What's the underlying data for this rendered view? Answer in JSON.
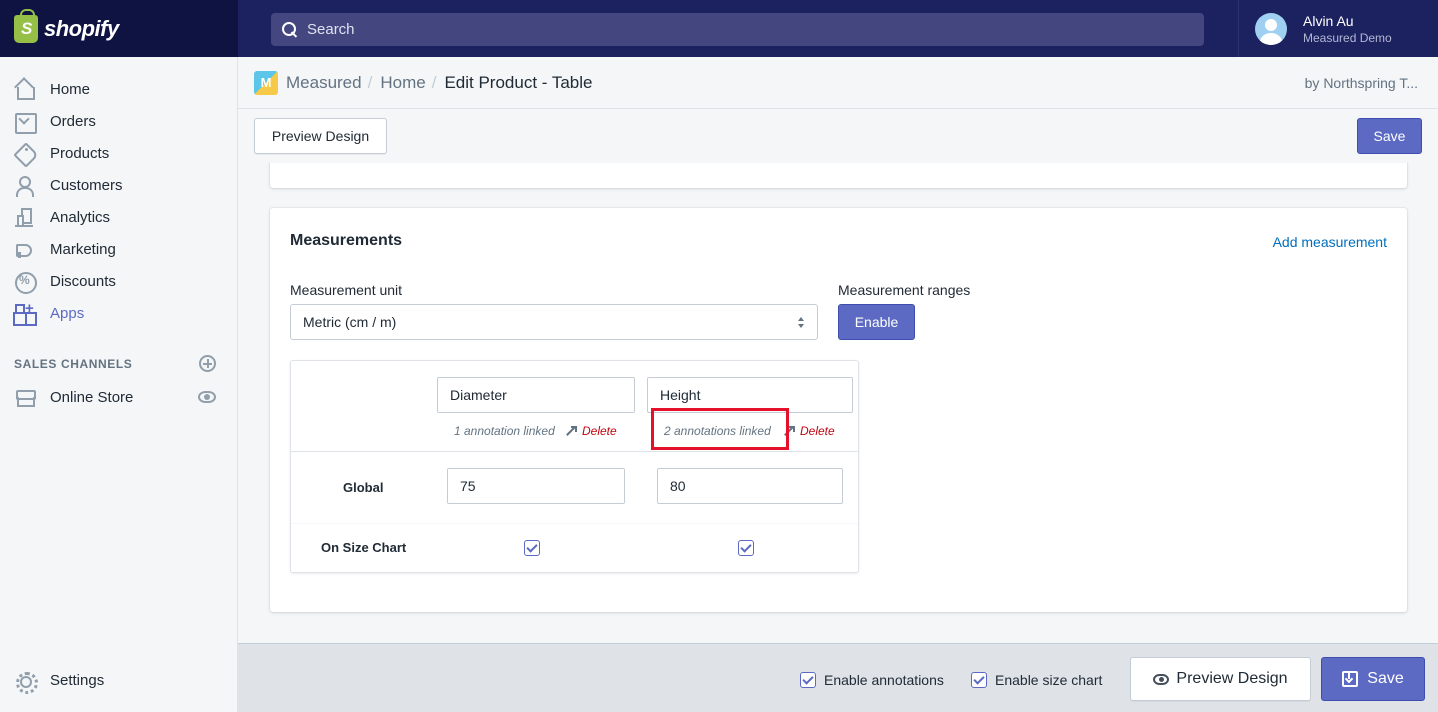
{
  "topbar": {
    "logo_text": "shopify",
    "search_placeholder": "Search",
    "user": {
      "name": "Alvin Au",
      "shop": "Measured Demo"
    }
  },
  "sidebar": {
    "items": [
      {
        "label": "Home",
        "icon": "home-icon"
      },
      {
        "label": "Orders",
        "icon": "orders-icon"
      },
      {
        "label": "Products",
        "icon": "tag-icon"
      },
      {
        "label": "Customers",
        "icon": "person-icon"
      },
      {
        "label": "Analytics",
        "icon": "bar-chart-icon"
      },
      {
        "label": "Marketing",
        "icon": "megaphone-icon"
      },
      {
        "label": "Discounts",
        "icon": "discount-icon"
      },
      {
        "label": "Apps",
        "icon": "apps-icon"
      }
    ],
    "sales_channels_label": "SALES CHANNELS",
    "online_store_label": "Online Store",
    "settings_label": "Settings",
    "active_color": "#5c6ac4"
  },
  "app_header": {
    "breadcrumb": [
      "Measured",
      "Home",
      "Edit Product - Table"
    ],
    "separator": "/",
    "by_text": "by Northspring T..."
  },
  "toolbar": {
    "preview_label": "Preview Design",
    "save_label": "Save"
  },
  "measurements": {
    "title": "Measurements",
    "add_link": "Add measurement",
    "unit_label": "Measurement unit",
    "unit_value": "Metric (cm / m)",
    "ranges_label": "Measurement ranges",
    "enable_label": "Enable",
    "columns": [
      {
        "name": "Diameter",
        "annotations": "1 annotation linked",
        "delete": "Delete",
        "global": "75"
      },
      {
        "name": "Height",
        "annotations": "2 annotations linked",
        "delete": "Delete",
        "global": "80"
      }
    ],
    "row_global_label": "Global",
    "row_size_chart_label": "On Size Chart"
  },
  "bottombar": {
    "enable_annotations": "Enable annotations",
    "enable_size_chart": "Enable size chart",
    "preview_label": "Preview Design",
    "save_label": "Save"
  },
  "colors": {
    "primary": "#5c6ac4",
    "topbar": "#1c2260",
    "delete": "#bf0711",
    "link": "#006fbb",
    "highlight": "#e5112a"
  }
}
